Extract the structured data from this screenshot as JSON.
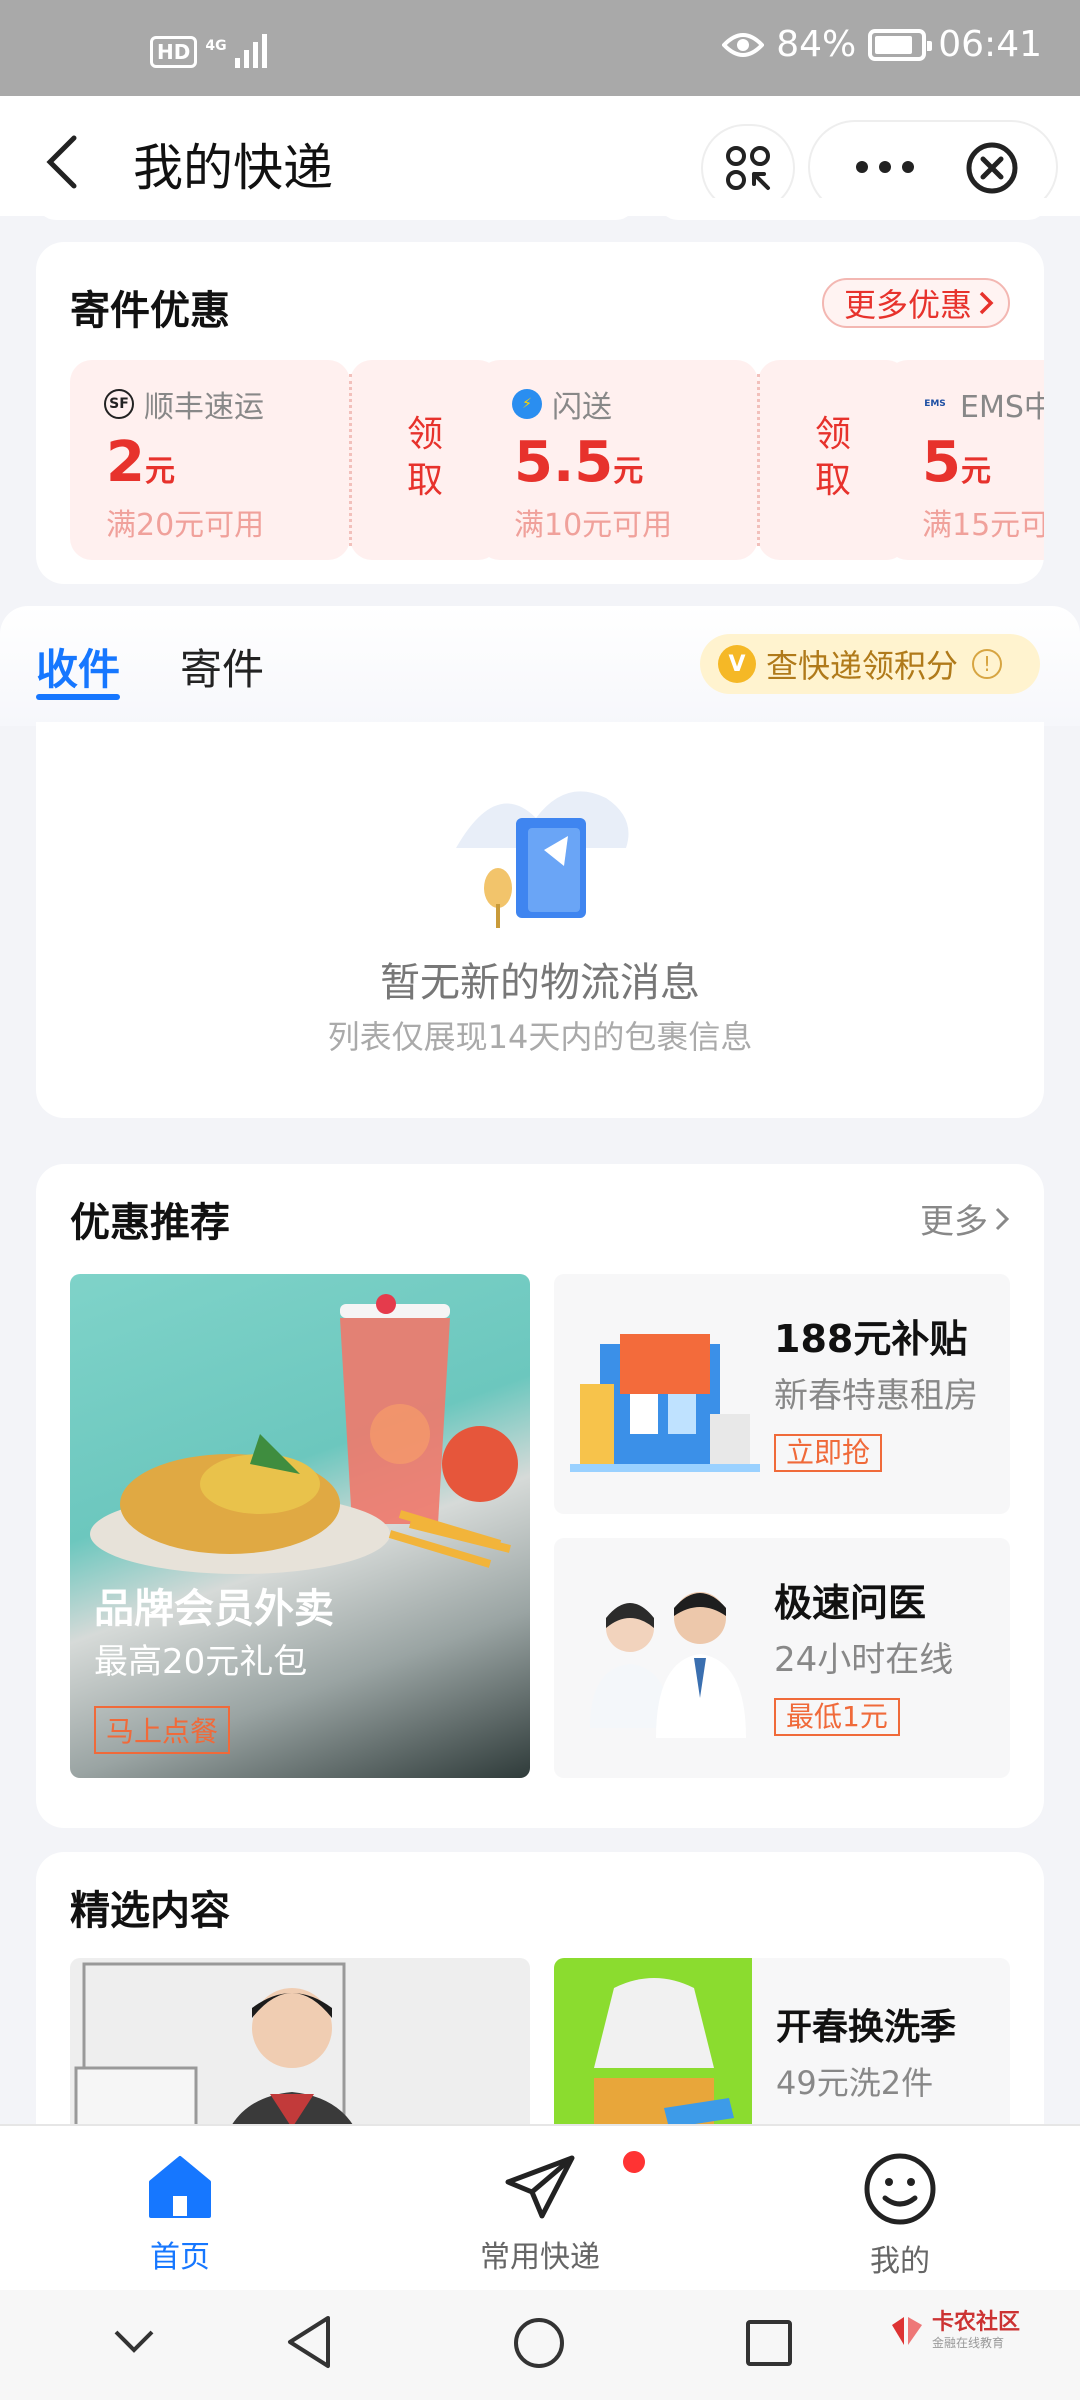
{
  "status_bar": {
    "hd": "HD",
    "network": "4G",
    "battery_percent": "84%",
    "battery_level": 0.84,
    "time": "06:41"
  },
  "header": {
    "title": "我的快递"
  },
  "coupon_section": {
    "title": "寄件优惠",
    "more_label": "更多优惠",
    "coupons": [
      {
        "brand": "顺丰速运",
        "logo_text": "SF",
        "amount": "2",
        "unit": "元",
        "condition": "满20元可用",
        "claim": "领取"
      },
      {
        "brand": "闪送",
        "logo_text": "⚡",
        "amount": "5.5",
        "unit": "元",
        "condition": "满10元可用",
        "claim": "领取"
      },
      {
        "brand": "EMS中",
        "logo_text": "EMS",
        "amount": "5",
        "unit": "元",
        "condition": "满15元可",
        "claim": ""
      }
    ]
  },
  "tabs": {
    "receive": "收件",
    "send": "寄件",
    "points_label": "查快递领积分",
    "coin_glyph": "V",
    "info_glyph": "!"
  },
  "empty_state": {
    "message": "暂无新的物流消息",
    "hint": "列表仅展现14天内的包裹信息"
  },
  "recommend": {
    "title": "优惠推荐",
    "more_label": "更多",
    "big": {
      "title": "品牌会员外卖",
      "subtitle": "最高20元礼包",
      "button": "马上点餐"
    },
    "small": [
      {
        "title": "188元补贴",
        "subtitle": "新春特惠租房",
        "tag": "立即抢"
      },
      {
        "title": "极速问医",
        "subtitle": "24小时在线",
        "tag": "最低1元"
      }
    ]
  },
  "selected": {
    "title": "精选内容",
    "right": {
      "title": "开春换洗季",
      "subtitle": "49元洗2件"
    }
  },
  "bottom_nav": [
    {
      "label": "首页",
      "icon": "home-icon",
      "active": true
    },
    {
      "label": "常用快递",
      "icon": "paper-plane-icon",
      "active": false
    },
    {
      "label": "我的",
      "icon": "smiley-icon",
      "active": false
    }
  ],
  "watermark": {
    "name": "卡农社区",
    "sub": "金融在线教育"
  },
  "colors": {
    "accent": "#1677ff",
    "coupon_red": "#e7322c",
    "orange": "#f06a3a",
    "gold": "#f5b826"
  }
}
